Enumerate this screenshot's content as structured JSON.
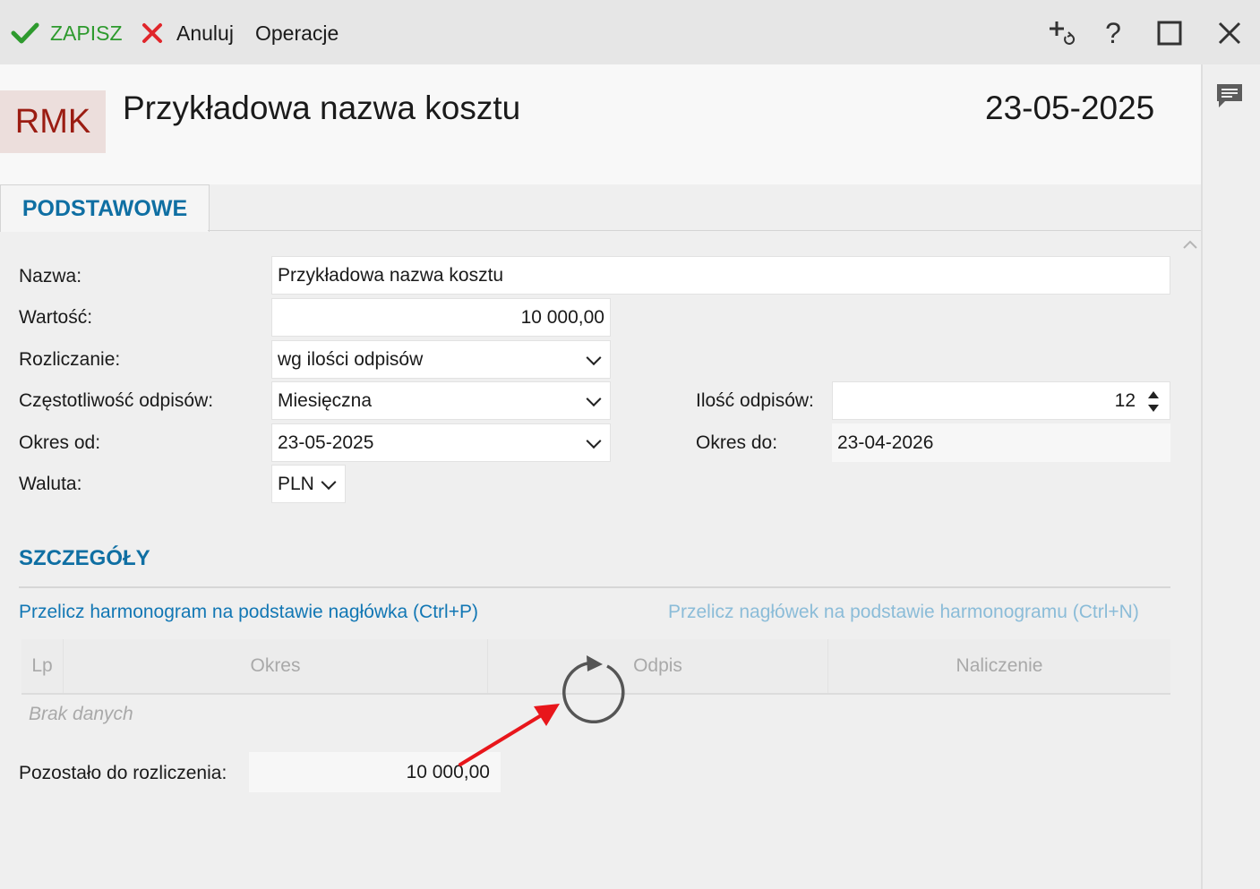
{
  "toolbar": {
    "save_label": "ZAPISZ",
    "cancel_label": "Anuluj",
    "operations_label": "Operacje",
    "icons": [
      "add-refresh-icon",
      "help-icon",
      "maximize-icon",
      "close-icon"
    ]
  },
  "header": {
    "badge": "RMK",
    "title": "Przykładowa nazwa kosztu",
    "date": "23-05-2025"
  },
  "tabs": [
    {
      "label": "PODSTAWOWE",
      "active": true
    }
  ],
  "form": {
    "name_label": "Nazwa:",
    "name_value": "Przykładowa nazwa kosztu",
    "value_label": "Wartość:",
    "value_value": "10 000,00",
    "settlement_label": "Rozliczanie:",
    "settlement_value": "wg ilości odpisów",
    "frequency_label": "Częstotliwość odpisów:",
    "frequency_value": "Miesięczna",
    "count_label": "Ilość odpisów:",
    "count_value": "12",
    "period_from_label": "Okres od:",
    "period_from_value": "23-05-2025",
    "period_to_label": "Okres do:",
    "period_to_value": "23-04-2026",
    "currency_label": "Waluta:",
    "currency_value": "PLN"
  },
  "details": {
    "section_title": "SZCZEGÓŁY",
    "recalc_schedule_link": "Przelicz harmonogram na podstawie nagłówka (Ctrl+P)",
    "recalc_header_link": "Przelicz nagłówek na podstawie harmonogramu (Ctrl+N)",
    "columns": [
      "Lp",
      "Okres",
      "Odpis",
      "Naliczenie"
    ],
    "empty_text": "Brak danych",
    "remaining_label": "Pozostało do rozliczenia:",
    "remaining_value": "10 000,00"
  },
  "colors": {
    "accent_blue": "#0f6fa3",
    "save_green": "#2e9a2e",
    "cancel_red": "#e0262b",
    "badge_text": "#9b1c12",
    "arrow_red": "#e8161b"
  }
}
